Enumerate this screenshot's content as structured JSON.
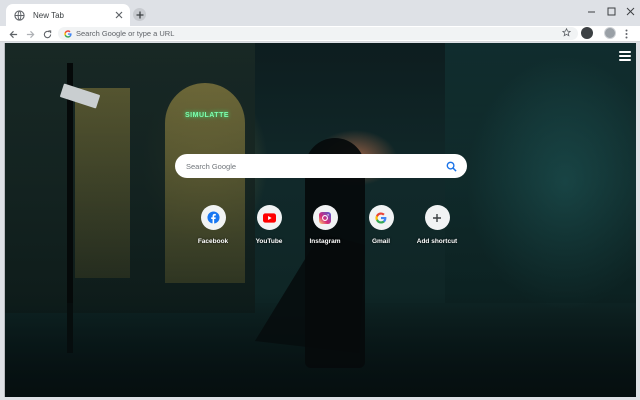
{
  "browser": {
    "tab": {
      "title": "New Tab",
      "favicon": "globe-icon"
    },
    "omnibox": {
      "placeholder": "Search Google or type a URL"
    },
    "accent": "#1a73e8"
  },
  "background": {
    "neon_sign_text": "SIMULATTE",
    "street_sign_text": ""
  },
  "search": {
    "placeholder": "Search Google"
  },
  "shortcuts": [
    {
      "label": "Facebook",
      "icon": "facebook-icon",
      "color": "#1877f2"
    },
    {
      "label": "YouTube",
      "icon": "youtube-icon",
      "color": "#ff0000"
    },
    {
      "label": "Instagram",
      "icon": "instagram-icon",
      "color": "#c13584"
    },
    {
      "label": "Gmail",
      "icon": "google-icon",
      "color": "#4285f4"
    },
    {
      "label": "Add shortcut",
      "icon": "plus-icon",
      "color": "#3c4043"
    }
  ]
}
